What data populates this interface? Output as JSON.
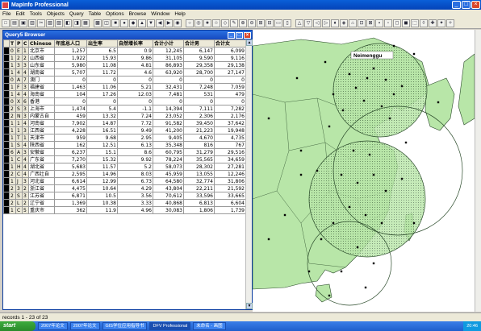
{
  "window": {
    "title": "MapInfo Professional"
  },
  "menu": [
    "File",
    "Edit",
    "Tools",
    "Objects",
    "Query",
    "Table",
    "Options",
    "Browse",
    "Window",
    "Help"
  ],
  "browser": {
    "title": "Query5 Browser",
    "columns": [
      "T",
      "P",
      "C",
      "Chinese",
      "年底总人口",
      "出生率",
      "自然增长率",
      "合计小计",
      "合计男",
      "合计女"
    ],
    "rows": [
      [
        "0",
        "E",
        "1",
        "北京市",
        "1,257",
        "6.5",
        "0.9",
        "12,245",
        "6,147",
        "6,099"
      ],
      [
        "1",
        "2",
        "2",
        "山西省",
        "1,922",
        "15.93",
        "9.86",
        "31,105",
        "9,590",
        "9,116"
      ],
      [
        "1",
        "3",
        "3",
        "山东省",
        "5,980",
        "11.08",
        "4.81",
        "86,893",
        "29,358",
        "29,138"
      ],
      [
        "1",
        "4",
        "4",
        "湖南省",
        "5,707",
        "11.72",
        "4.6",
        "63,920",
        "28,700",
        "27,147"
      ],
      [
        "0",
        "A",
        "7",
        "澳门",
        "0",
        "0",
        "0",
        "0",
        "0",
        "0"
      ],
      [
        "1",
        "F",
        "3",
        "福建省",
        "1,463",
        "11.06",
        "5.21",
        "32,431",
        "7,248",
        "7,059"
      ],
      [
        "1",
        "4",
        "4",
        "海南省",
        "104",
        "17.26",
        "12.03",
        "7,481",
        "531",
        "479"
      ],
      [
        "0",
        "X",
        "6",
        "香港",
        "0",
        "0",
        "0",
        "0",
        "0",
        "0"
      ],
      [
        "2",
        "S",
        "3",
        "上海市",
        "1,474",
        "5.4",
        "-1.1",
        "14,394",
        "7,111",
        "7,282"
      ],
      [
        "2",
        "N",
        "3",
        "内蒙古自",
        "459",
        "13.32",
        "7.24",
        "23,052",
        "2,306",
        "2,176"
      ],
      [
        "1",
        "1",
        "4",
        "河南省",
        "7,902",
        "14.87",
        "7.72",
        "91,582",
        "39,450",
        "37,642"
      ],
      [
        "1",
        "1",
        "3",
        "江西省",
        "4,228",
        "16.51",
        "9.49",
        "41,200",
        "21,223",
        "19,948"
      ],
      [
        "1",
        "T",
        "1",
        "天津市",
        "959",
        "9.68",
        "2.95",
        "9,405",
        "4,670",
        "4,735"
      ],
      [
        "1",
        "S",
        "4",
        "陕西省",
        "162",
        "12.51",
        "6.13",
        "35,348",
        "816",
        "767"
      ],
      [
        "6",
        "A",
        "3",
        "安徽省",
        "6,237",
        "15.1",
        "8.6",
        "60,795",
        "31,279",
        "29,516"
      ],
      [
        "1",
        "C",
        "4",
        "广东省",
        "7,270",
        "15.32",
        "9.92",
        "78,224",
        "35,565",
        "34,659"
      ],
      [
        "1",
        "H",
        "4",
        "湖北省",
        "5,683",
        "11.57",
        "5.2",
        "58,073",
        "28,302",
        "27,281"
      ],
      [
        "2",
        "C",
        "4",
        "广西壮自",
        "2,595",
        "14.96",
        "8.03",
        "45,959",
        "13,055",
        "12,246"
      ],
      [
        "1",
        "J",
        "3",
        "河北省",
        "6,614",
        "12.99",
        "6.73",
        "64,580",
        "32,774",
        "31,806"
      ],
      [
        "2",
        "3",
        "2",
        "浙江省",
        "4,475",
        "10.64",
        "4.29",
        "43,804",
        "22,211",
        "21,592"
      ],
      [
        "2",
        "S",
        "3",
        "江苏省",
        "6,871",
        "10.5",
        "3.56",
        "70,612",
        "33,596",
        "33,665"
      ],
      [
        "2",
        "L",
        "2",
        "辽宁省",
        "1,369",
        "10.38",
        "3.33",
        "40,868",
        "6,813",
        "6,604"
      ],
      [
        "1",
        "C",
        "5",
        "重庆市",
        "362",
        "11.9",
        "4.96",
        "30,083",
        "1,806",
        "1,739"
      ]
    ]
  },
  "map": {
    "label": "Neimenggu"
  },
  "status": {
    "text": "records 1 - 23 of 23"
  },
  "taskbar": {
    "start": "start",
    "tasks": [
      "2007年论文",
      "2007年论文",
      "GIS学位应用指导书",
      "DFV Professional",
      "未命名 - 画图"
    ],
    "clock": "20:46"
  }
}
